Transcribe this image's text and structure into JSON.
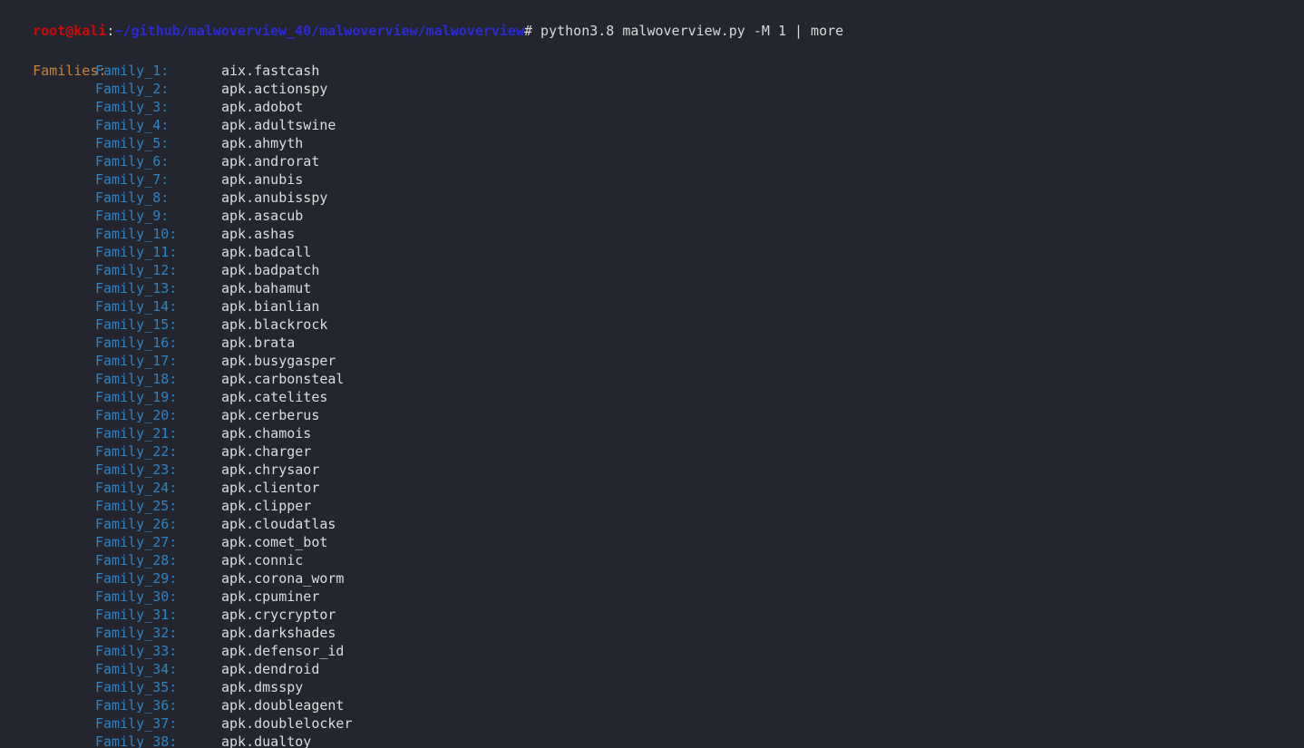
{
  "terminal": {
    "background_color": "#23262e",
    "prompt": {
      "user_host": "root@kali",
      "separator": ":",
      "path": "~/github/malwoverview_40/malwoverview/malwoverview",
      "sigil": "#",
      "command": " python3.8 malwoverview.py -M 1 | more",
      "colors": {
        "user_host": "#cc0a0a",
        "path": "#2b2bd0",
        "command": "#d8d8d8",
        "separator": "#d6d6d6"
      }
    },
    "output": {
      "section_header": "Families:",
      "section_header_color": "#c8813c",
      "key_color": "#2e84c4",
      "value_color": "#dcdcdc",
      "rows": [
        {
          "key": "Family_1:",
          "value": "aix.fastcash"
        },
        {
          "key": "Family_2:",
          "value": "apk.actionspy"
        },
        {
          "key": "Family_3:",
          "value": "apk.adobot"
        },
        {
          "key": "Family_4:",
          "value": "apk.adultswine"
        },
        {
          "key": "Family_5:",
          "value": "apk.ahmyth"
        },
        {
          "key": "Family_6:",
          "value": "apk.androrat"
        },
        {
          "key": "Family_7:",
          "value": "apk.anubis"
        },
        {
          "key": "Family_8:",
          "value": "apk.anubisspy"
        },
        {
          "key": "Family_9:",
          "value": "apk.asacub"
        },
        {
          "key": "Family_10:",
          "value": "apk.ashas"
        },
        {
          "key": "Family_11:",
          "value": "apk.badcall"
        },
        {
          "key": "Family_12:",
          "value": "apk.badpatch"
        },
        {
          "key": "Family_13:",
          "value": "apk.bahamut"
        },
        {
          "key": "Family_14:",
          "value": "apk.bianlian"
        },
        {
          "key": "Family_15:",
          "value": "apk.blackrock"
        },
        {
          "key": "Family_16:",
          "value": "apk.brata"
        },
        {
          "key": "Family_17:",
          "value": "apk.busygasper"
        },
        {
          "key": "Family_18:",
          "value": "apk.carbonsteal"
        },
        {
          "key": "Family_19:",
          "value": "apk.catelites"
        },
        {
          "key": "Family_20:",
          "value": "apk.cerberus"
        },
        {
          "key": "Family_21:",
          "value": "apk.chamois"
        },
        {
          "key": "Family_22:",
          "value": "apk.charger"
        },
        {
          "key": "Family_23:",
          "value": "apk.chrysaor"
        },
        {
          "key": "Family_24:",
          "value": "apk.clientor"
        },
        {
          "key": "Family_25:",
          "value": "apk.clipper"
        },
        {
          "key": "Family_26:",
          "value": "apk.cloudatlas"
        },
        {
          "key": "Family_27:",
          "value": "apk.comet_bot"
        },
        {
          "key": "Family_28:",
          "value": "apk.connic"
        },
        {
          "key": "Family_29:",
          "value": "apk.corona_worm"
        },
        {
          "key": "Family_30:",
          "value": "apk.cpuminer"
        },
        {
          "key": "Family_31:",
          "value": "apk.crycryptor"
        },
        {
          "key": "Family_32:",
          "value": "apk.darkshades"
        },
        {
          "key": "Family_33:",
          "value": "apk.defensor_id"
        },
        {
          "key": "Family_34:",
          "value": "apk.dendroid"
        },
        {
          "key": "Family_35:",
          "value": "apk.dmsspy"
        },
        {
          "key": "Family_36:",
          "value": "apk.doubleagent"
        },
        {
          "key": "Family_37:",
          "value": "apk.doublelocker"
        },
        {
          "key": "Family_38:",
          "value": "apk.dualtoy"
        }
      ]
    }
  }
}
